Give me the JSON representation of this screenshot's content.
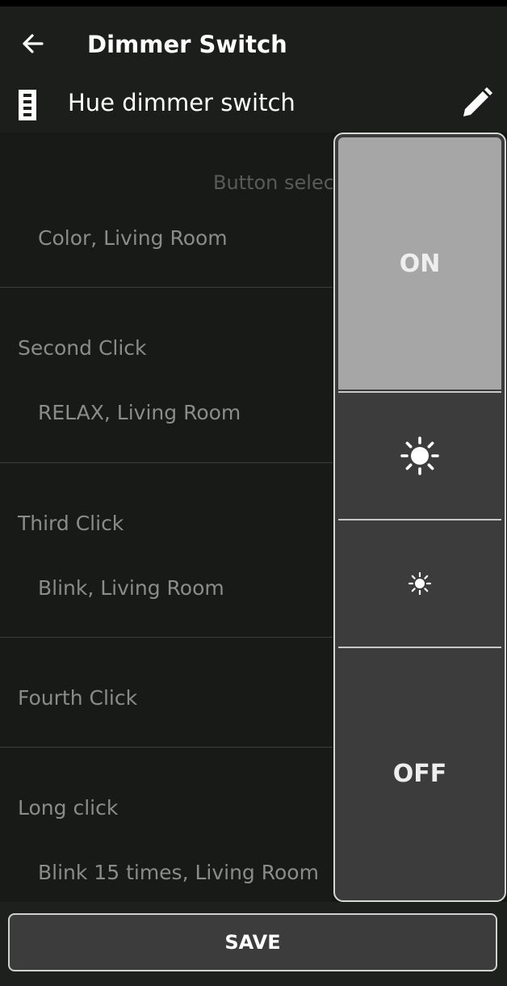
{
  "app": {
    "title": "Dimmer Switch"
  },
  "device": {
    "name": "Hue dimmer switch"
  },
  "list": {
    "hint": "Button selec",
    "first": {
      "value": "Color, Living Room"
    },
    "second": {
      "title": "Second Click",
      "value": "RELAX, Living Room"
    },
    "third": {
      "title": "Third Click",
      "value": "Blink, Living Room"
    },
    "fourth": {
      "title": "Fourth Click"
    },
    "long": {
      "title": "Long click",
      "value": "Blink 15 times, Living Room"
    }
  },
  "remote": {
    "on_label": "ON",
    "off_label": "OFF",
    "up_icon": "brightness-up-icon",
    "down_icon": "brightness-down-icon"
  },
  "footer": {
    "save_label": "SAVE"
  },
  "colors": {
    "background": "#141614",
    "appbar": "#1c1e1c",
    "on_button": "#a5a6a5",
    "remote_body": "#3b3c3b"
  }
}
